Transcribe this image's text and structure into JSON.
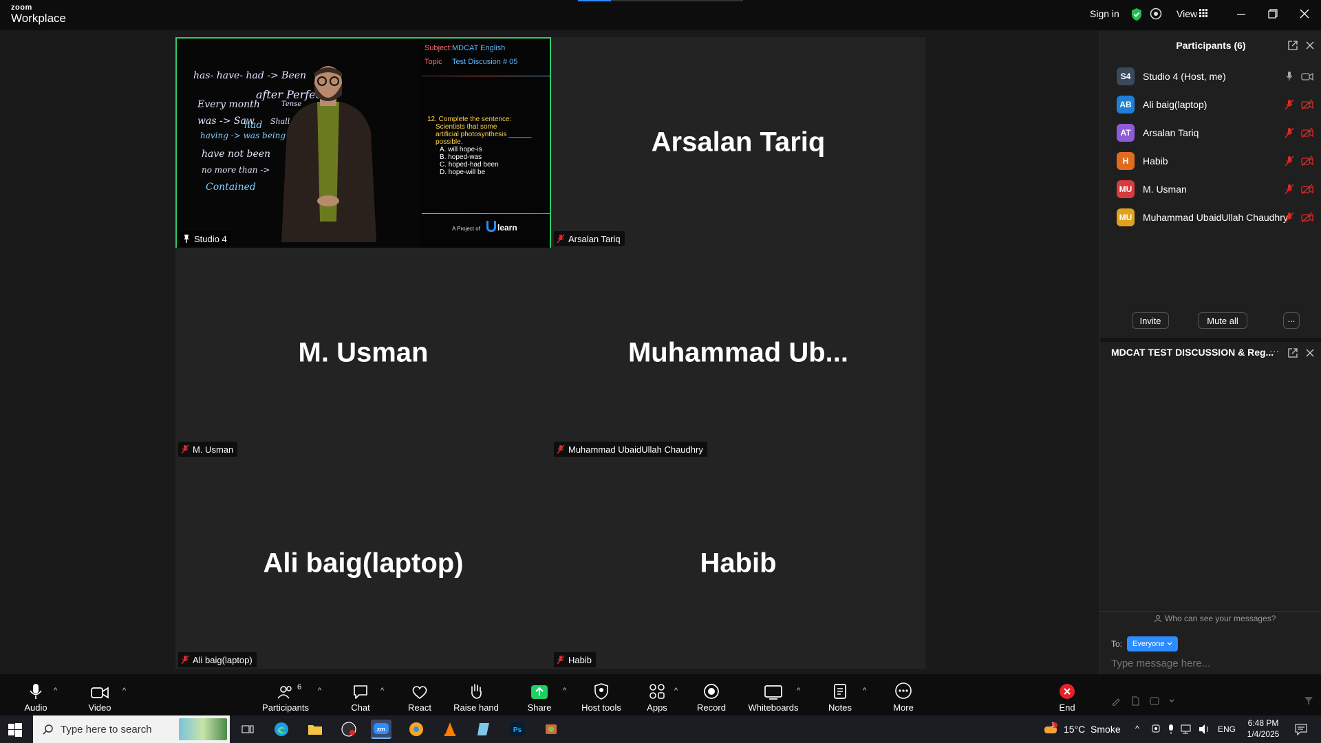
{
  "titlebar": {
    "logo_top": "zoom",
    "logo_bottom": "Workplace",
    "sign_in": "Sign in",
    "view": "View"
  },
  "tiles": {
    "studio": {
      "tag": "Studio 4"
    },
    "arsalan": {
      "name": "Arsalan Tariq",
      "tag": "Arsalan Tariq"
    },
    "usman": {
      "name": "M. Usman",
      "tag": "M. Usman"
    },
    "muhammad": {
      "name": "Muhammad  Ub...",
      "tag": "Muhammad UbaidUllah Chaudhry"
    },
    "ali": {
      "name": "Ali baig(laptop)",
      "tag": "Ali baig(laptop)"
    },
    "habib": {
      "name": "Habib",
      "tag": "Habib"
    }
  },
  "slide": {
    "subject_label": "Subject:",
    "subject_value": "MDCAT English",
    "topic_label": "Topic",
    "topic_value": "Test Discusion # 05",
    "question": [
      "12. Complete the sentence:",
      "Scientists        that some",
      "artificial photosynthesis ______",
      "possible."
    ],
    "options": [
      "A. will hope-is",
      "B. hoped-was",
      "C. hoped-had been",
      "D. hope-will be"
    ],
    "footer": "A Project of",
    "brand": "learn",
    "board_lines": [
      "has- have- had -> Been",
      "Every month",
      "after Perfect",
      "Tense",
      "was -> Saw",
      "had",
      "Shall have",
      "having -> was being",
      "have not  been",
      "no more than ->",
      "Contained"
    ]
  },
  "participants_panel": {
    "title": "Participants (6)",
    "participants": [
      {
        "initials": "S4",
        "name": "Studio 4 (Host, me)",
        "color": "#3a4a5c",
        "muted": false
      },
      {
        "initials": "AB",
        "name": "Ali baig(laptop)",
        "color": "#1f7fd6",
        "muted": true
      },
      {
        "initials": "AT",
        "name": "Arsalan Tariq",
        "color": "#8e5bd6",
        "muted": true
      },
      {
        "initials": "H",
        "name": "Habib",
        "color": "#e06b1f",
        "muted": true
      },
      {
        "initials": "MU",
        "name": "M. Usman",
        "color": "#d63c3c",
        "muted": true
      },
      {
        "initials": "MU",
        "name": "Muhammad UbaidUllah Chaudhry",
        "color": "#e0a21a",
        "muted": true
      }
    ],
    "invite": "Invite",
    "mute_all": "Mute all",
    "more": "..."
  },
  "chat_panel": {
    "title": "MDCAT TEST DISCUSSION & Reg...",
    "who_can_see": "Who can see your messages?",
    "to_label": "To:",
    "to_value": "Everyone",
    "placeholder": "Type message here..."
  },
  "toolbar": {
    "audio": "Audio",
    "video": "Video",
    "participants": "Participants",
    "participants_count": "6",
    "chat": "Chat",
    "react": "React",
    "raise_hand": "Raise hand",
    "share": "Share",
    "host_tools": "Host tools",
    "apps": "Apps",
    "record": "Record",
    "whiteboards": "Whiteboards",
    "notes": "Notes",
    "more": "More",
    "end": "End"
  },
  "taskbar": {
    "search_placeholder": "Type here to search",
    "weather": "15°C  Smoke",
    "weather_badge": "1",
    "lang": "ENG",
    "time": "6:48 PM",
    "date": "1/4/2025"
  },
  "colors": {
    "accent": "#2d8cff",
    "active_speaker": "#2fcb6e",
    "muted_red": "#e02828",
    "share_green": "#1fcf63",
    "end_red": "#e5222b"
  }
}
